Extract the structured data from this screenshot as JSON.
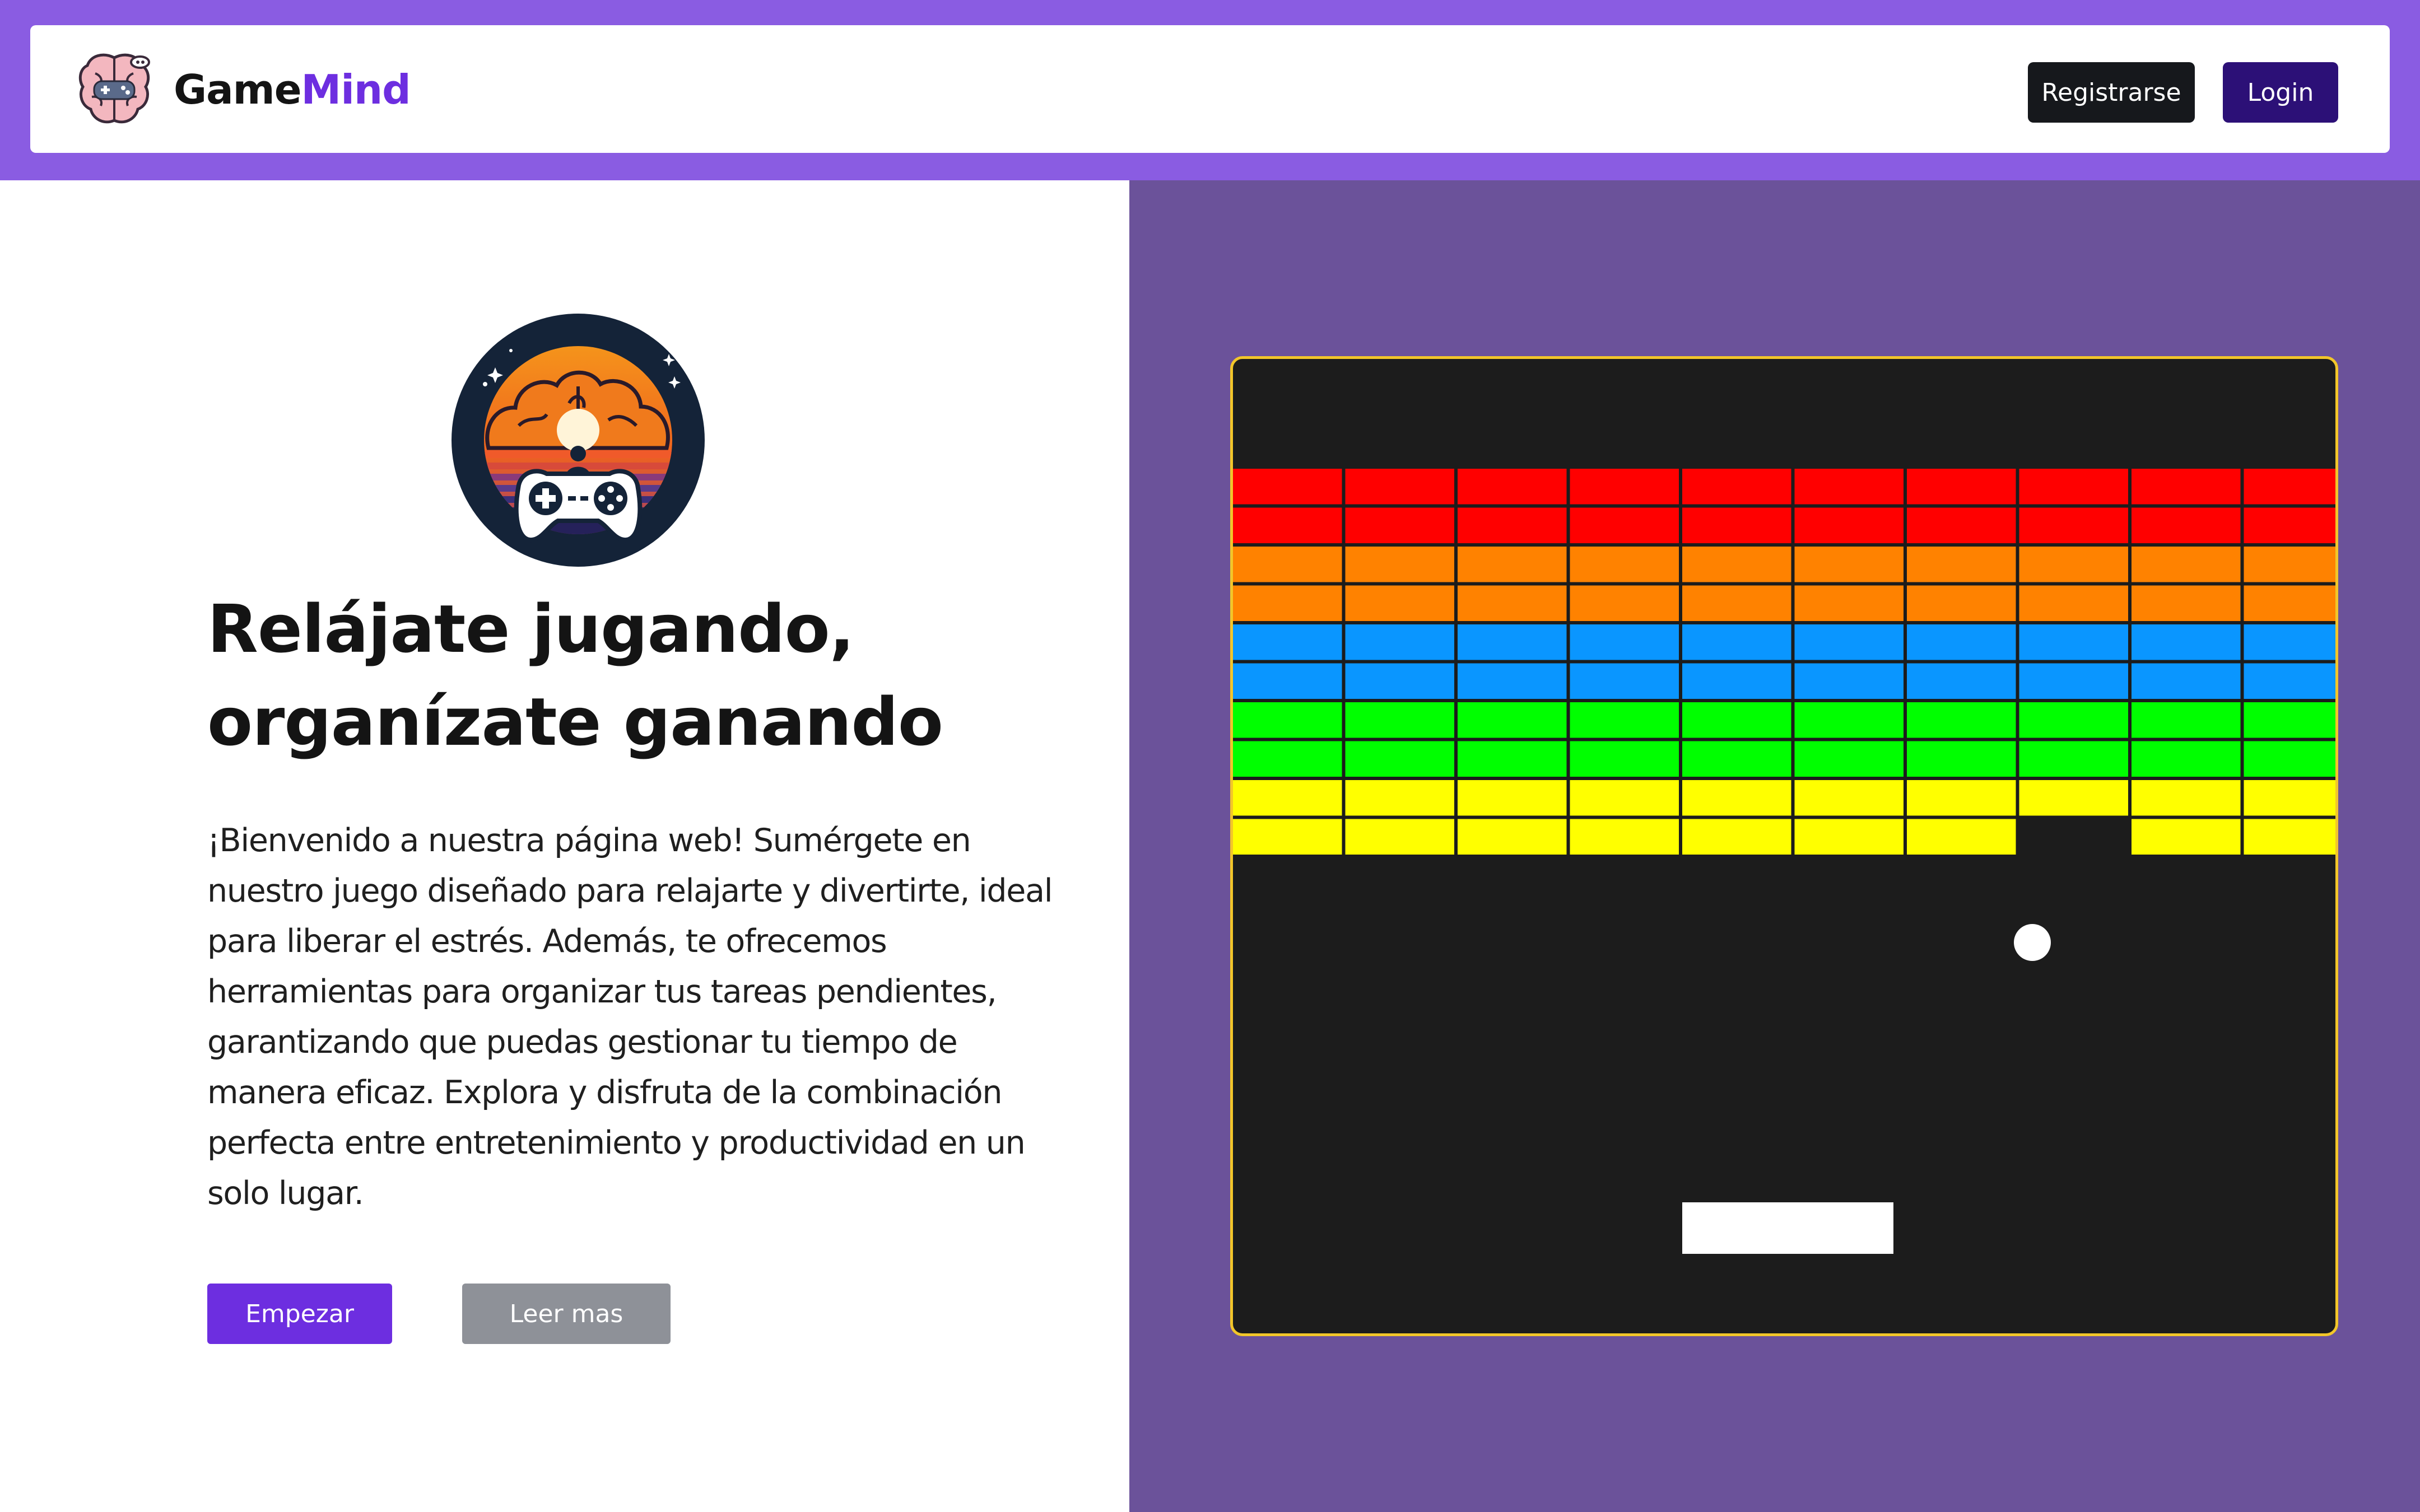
{
  "header": {
    "brand_primary": "Game",
    "brand_accent": "Mind",
    "register_label": "Registrarse",
    "login_label": "Login"
  },
  "hero": {
    "headline_line1": "Relájate jugando,",
    "headline_line2": "organízate ganando",
    "intro": "¡Bienvenido a nuestra página web! Sumérgete en nuestro juego diseñado para relajarte y divertirte, ideal para liberar el estrés. Además, te ofrecemos herramientas para organizar tus tareas pendientes, garantizando que puedas gestionar tu tiempo de manera eficaz. Explora y disfruta de la combinación perfecta entre entretenimiento y productividad en un solo lugar.",
    "start_label": "Empezar",
    "more_label": "Leer mas"
  },
  "game": {
    "brick_rows": [
      {
        "color": "#ff0000",
        "bricks": [
          1,
          1,
          1,
          1,
          1,
          1,
          1,
          1,
          1,
          1
        ]
      },
      {
        "color": "#ff0000",
        "bricks": [
          1,
          1,
          1,
          1,
          1,
          1,
          1,
          1,
          1,
          1
        ]
      },
      {
        "color": "#ff8200",
        "bricks": [
          1,
          1,
          1,
          1,
          1,
          1,
          1,
          1,
          1,
          1
        ]
      },
      {
        "color": "#ff8200",
        "bricks": [
          1,
          1,
          1,
          1,
          1,
          1,
          1,
          1,
          1,
          1
        ]
      },
      {
        "color": "#0a96ff",
        "bricks": [
          1,
          1,
          1,
          1,
          1,
          1,
          1,
          1,
          1,
          1
        ]
      },
      {
        "color": "#0a96ff",
        "bricks": [
          1,
          1,
          1,
          1,
          1,
          1,
          1,
          1,
          1,
          1
        ]
      },
      {
        "color": "#00ff00",
        "bricks": [
          1,
          1,
          1,
          1,
          1,
          1,
          1,
          1,
          1,
          1
        ]
      },
      {
        "color": "#00ff00",
        "bricks": [
          1,
          1,
          1,
          1,
          1,
          1,
          1,
          1,
          1,
          1
        ]
      },
      {
        "color": "#ffff00",
        "bricks": [
          1,
          1,
          1,
          1,
          1,
          1,
          1,
          1,
          1,
          1
        ]
      },
      {
        "color": "#ffff00",
        "bricks": [
          1,
          1,
          1,
          1,
          1,
          1,
          1,
          0,
          1,
          1
        ]
      }
    ],
    "background_color": "#1c1c1c",
    "border_color": "#f2c62a",
    "ball_color": "#ffffff",
    "paddle_color": "#ffffff"
  },
  "theme": {
    "brand_purple": "#8a5ce2",
    "accent_purple": "#6d2ee0",
    "panel_purple": "#6b529a",
    "login_purple": "#2c1077"
  },
  "icons": {
    "brand_logo": "brain-gamepad-icon",
    "hero_logo": "brain-sunset-gamepad-icon"
  }
}
